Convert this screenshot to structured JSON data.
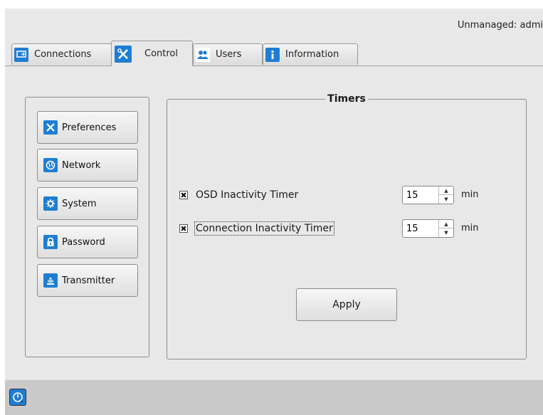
{
  "status": {
    "user_text": "Unmanaged: admi"
  },
  "tabs": [
    {
      "label": "Connections",
      "icon": "connections-icon",
      "active": false
    },
    {
      "label": "Control",
      "icon": "tools-icon",
      "active": true
    },
    {
      "label": "Users",
      "icon": "users-icon",
      "active": false
    },
    {
      "label": "Information",
      "icon": "info-icon",
      "active": false
    }
  ],
  "sidebar": {
    "items": [
      {
        "label": "Preferences",
        "icon": "tools-icon"
      },
      {
        "label": "Network",
        "icon": "globe-icon"
      },
      {
        "label": "System",
        "icon": "gear-icon"
      },
      {
        "label": "Password",
        "icon": "lock-icon"
      },
      {
        "label": "Transmitter",
        "icon": "transmitter-icon"
      }
    ]
  },
  "timers": {
    "title": "Timers",
    "rows": [
      {
        "label": "OSD Inactivity Timer",
        "checked": true,
        "value": "15",
        "unit": "min"
      },
      {
        "label": "Connection Inactivity Timer",
        "checked": true,
        "value": "15",
        "unit": "min"
      }
    ],
    "check_mark": "✖",
    "apply_label": "Apply"
  },
  "colors": {
    "accent": "#1f7ed3",
    "panel_bg": "#e8e8e8",
    "bottom_bar": "#c9c9c9"
  }
}
